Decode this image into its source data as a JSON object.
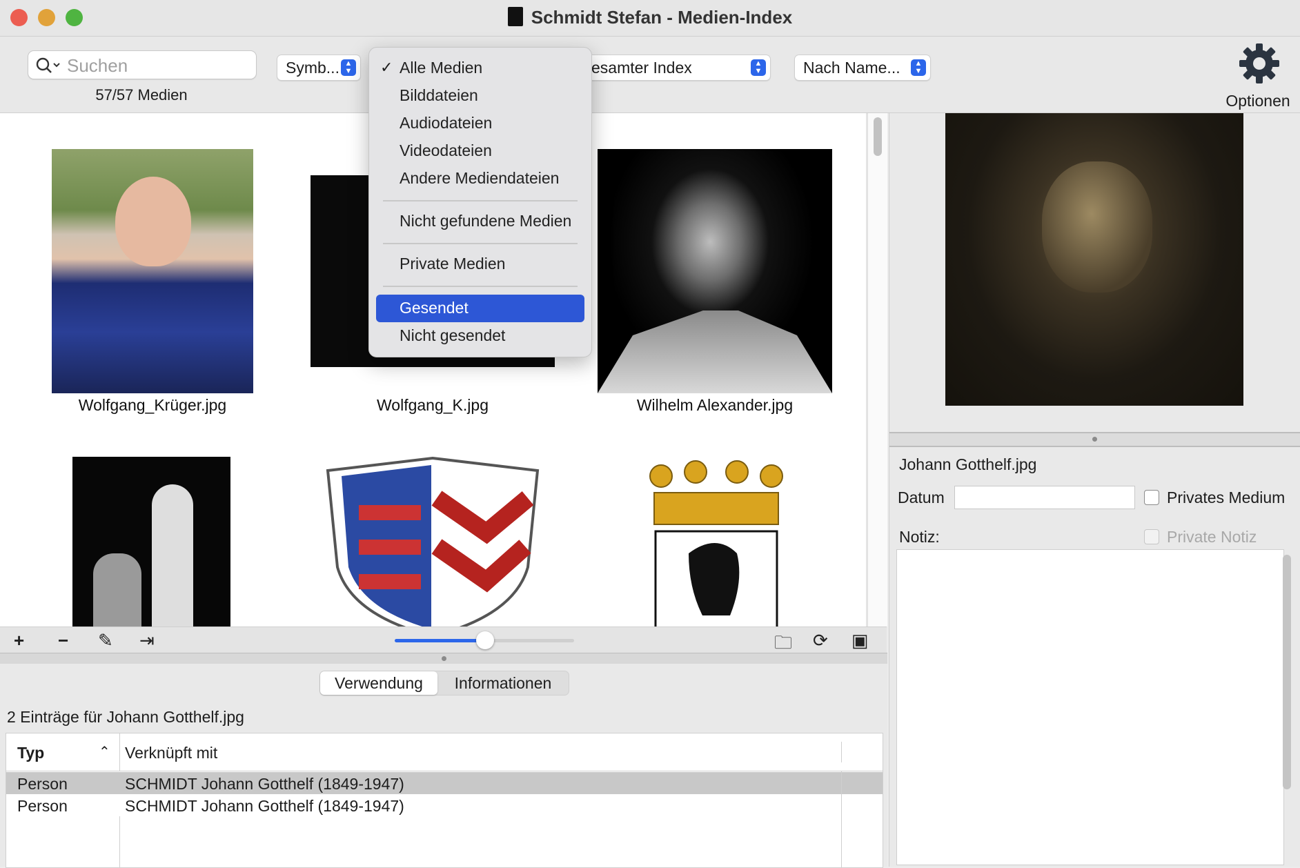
{
  "window": {
    "title": "Schmidt Stefan - Medien-Index",
    "buttons": {
      "close": "#ec5d51",
      "minimize": "#e1a23a",
      "zoom": "#4fb441"
    }
  },
  "toolbar": {
    "search_placeholder": "Suchen",
    "count": "57/57 Medien",
    "view_popup": "Symb...",
    "scope_popup": "esamter Index",
    "sort_popup": "Nach Name...",
    "options_label": "Optionen",
    "accent": "#2c66ea"
  },
  "filter_menu": {
    "items": [
      {
        "label": "Alle Medien",
        "checked": true
      },
      {
        "label": "Bilddateien"
      },
      {
        "label": "Audiodateien"
      },
      {
        "label": "Videodateien"
      },
      {
        "label": "Andere Mediendateien"
      },
      {
        "label": "Nicht gefundene Medien"
      },
      {
        "label": "Private Medien"
      },
      {
        "label": "Gesendet",
        "highlighted": true
      },
      {
        "label": "Nicht gesendet"
      }
    ],
    "highlight_color": "#2d57d6"
  },
  "media": [
    {
      "caption": "Wolfgang_Krüger.jpg"
    },
    {
      "caption": "Wolfgang_K.jpg"
    },
    {
      "caption": "Wilhelm Alexander.jpg"
    },
    {
      "caption": ""
    },
    {
      "caption": ""
    },
    {
      "caption": ""
    }
  ],
  "thumb_size_slider": {
    "value": 0.5
  },
  "lower_pane": {
    "tabs": [
      {
        "label": "Verwendung",
        "selected": true
      },
      {
        "label": "Informationen"
      }
    ],
    "summary": "2 Einträge für Johann Gotthelf.jpg",
    "columns": [
      "Typ",
      "Verknüpft mit"
    ],
    "rows": [
      {
        "type": "Person",
        "linked": "SCHMIDT Johann Gotthelf (1849-1947)"
      },
      {
        "type": "Person",
        "linked": "SCHMIDT Johann Gotthelf (1849-1947)"
      }
    ]
  },
  "detail_pane": {
    "filename": "Johann Gotthelf.jpg",
    "date_label": "Datum",
    "date_value": "",
    "private_medium_label": "Privates Medium",
    "note_label": "Notiz:",
    "private_note_label": "Private Notiz"
  }
}
